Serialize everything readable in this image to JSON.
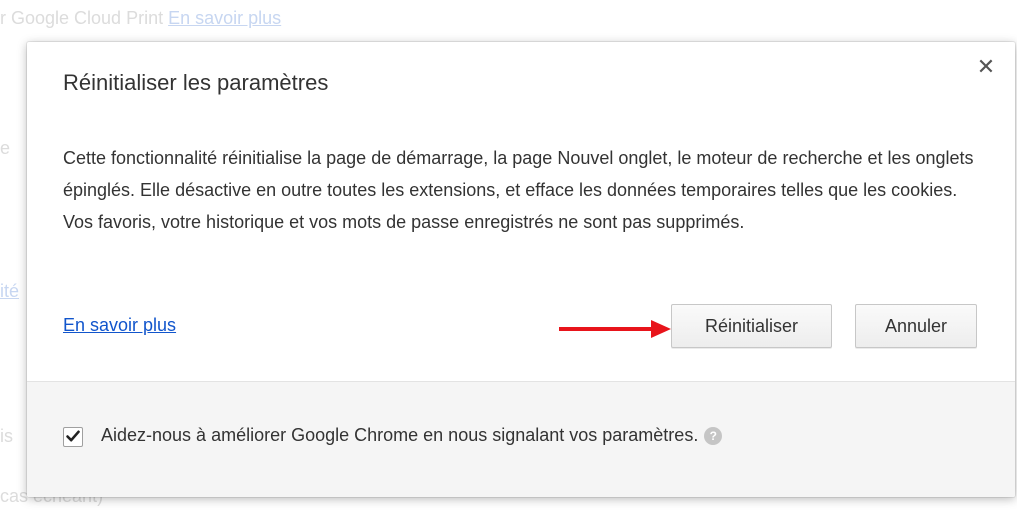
{
  "background": {
    "top_line_text": "r Google Cloud Print",
    "top_line_link": "En savoir plus",
    "fragment_1": "e",
    "fragment_2": "ité",
    "fragment_3": "is",
    "fragment_4": "cas échéant)"
  },
  "dialog": {
    "title": "Réinitialiser les paramètres",
    "close_glyph": "✕",
    "body": "Cette fonctionnalité réinitialise la page de démarrage, la page Nouvel onglet, le moteur de recherche et les onglets épinglés. Elle désactive en outre toutes les extensions, et efface les données temporaires telles que les cookies. Vos favoris, votre historique et vos mots de passe enregistrés ne sont pas supprimés.",
    "learn_more": "En savoir plus",
    "reset_label": "Réinitialiser",
    "cancel_label": "Annuler",
    "feedback_label": "Aidez-nous à améliorer Google Chrome en nous signalant vos paramètres.",
    "feedback_checked": true,
    "help_glyph": "?"
  },
  "colors": {
    "link": "#1155cc",
    "arrow": "#e8141b",
    "footer_bg": "#f5f5f5"
  },
  "icons": {
    "close": "close-icon",
    "checkmark": "checkmark-icon",
    "help": "help-icon",
    "arrow": "red-arrow-annotation"
  }
}
